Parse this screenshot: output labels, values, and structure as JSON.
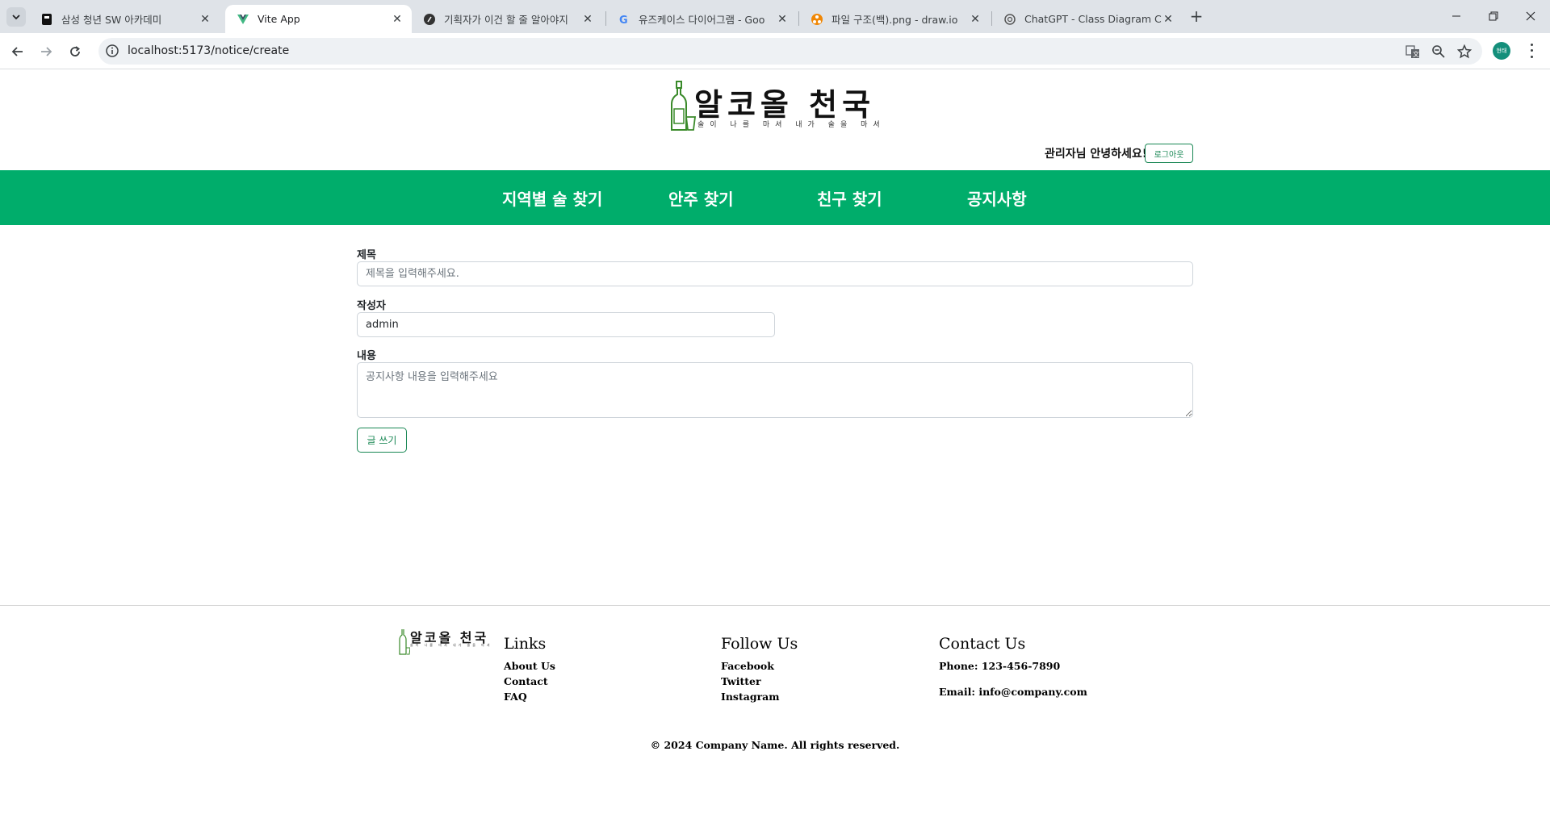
{
  "browser": {
    "tabs": [
      {
        "title": "삼성 청년 SW 아카데미",
        "active": false,
        "icon": "ssafy-icon"
      },
      {
        "title": "Vite App",
        "active": true,
        "icon": "vue-icon"
      },
      {
        "title": "기획자가 이건 할 줄 알아야지",
        "active": false,
        "icon": "velog-icon"
      },
      {
        "title": "유즈케이스 다이어그램 - Goo",
        "active": false,
        "icon": "google-icon"
      },
      {
        "title": "파일 구조(백).png - draw.io",
        "active": false,
        "icon": "drawio-icon"
      },
      {
        "title": "ChatGPT - Class Diagram Crea",
        "active": false,
        "icon": "chatgpt-icon"
      }
    ],
    "url": "localhost:5173/notice/create",
    "profile_label": "현태"
  },
  "header": {
    "logo_title": "알코올 천국",
    "logo_subtitle": "술이 나를 마셔 내가 술을 마셔",
    "greeting": "관리자님 안녕하세요!",
    "logout_label": "로그아웃"
  },
  "nav": {
    "items": [
      "지역별 술 찾기",
      "안주 찾기",
      "친구 찾기",
      "공지사항"
    ]
  },
  "form": {
    "title_label": "제목",
    "title_placeholder": "제목을 입력해주세요.",
    "author_label": "작성자",
    "author_value": "admin",
    "content_label": "내용",
    "content_placeholder": "공지사항 내용을 입력해주세요",
    "submit_label": "글 쓰기"
  },
  "footer": {
    "logo_title": "알코올 천국",
    "logo_subtitle": "술이 나를 마셔 내가 술을 마셔",
    "links_heading": "Links",
    "links": [
      "About Us",
      "Contact",
      "FAQ"
    ],
    "follow_heading": "Follow Us",
    "follow": [
      "Facebook",
      "Twitter",
      "Instagram"
    ],
    "contact_heading": "Contact Us",
    "phone": "Phone: 123-456-7890",
    "email": "Email: info@company.com",
    "copyright": "© 2024 Company Name. All rights reserved."
  },
  "colors": {
    "brand_green": "#00ad6b",
    "button_green": "#198754"
  }
}
